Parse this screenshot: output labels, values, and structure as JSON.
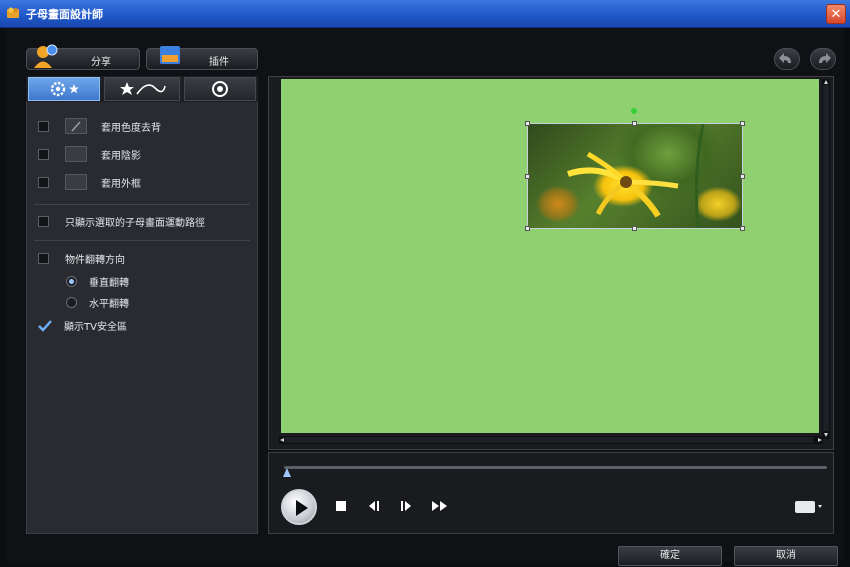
{
  "window": {
    "title": "子母畫面設計師",
    "close_glyph": "✕"
  },
  "toolbar": {
    "share_label": "分享",
    "download_label": "插件"
  },
  "left_panel": {
    "tab_icons": [
      "gear-star-icon",
      "fx-curve-icon",
      "target-icon"
    ],
    "options": [
      {
        "label": "套用色度去背",
        "checked": false
      },
      {
        "label": "套用陰影",
        "checked": false
      },
      {
        "label": "套用外框",
        "checked": false
      }
    ],
    "preview_option": {
      "label": "只顯示選取的子母畫面運動路徑",
      "checked": false
    },
    "flip_option": {
      "label": "物件翻轉方向",
      "checked": false
    },
    "radios": [
      {
        "label": "垂直翻轉",
        "selected": true
      },
      {
        "label": "水平翻轉",
        "selected": false
      }
    ],
    "tv_safe": {
      "label": "顯示TV安全區",
      "checked": true
    }
  },
  "footer": {
    "ok_label": "確定",
    "cancel_label": "取消"
  }
}
